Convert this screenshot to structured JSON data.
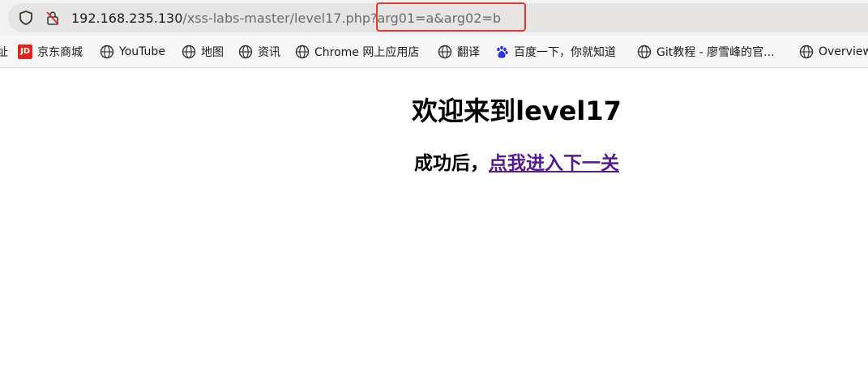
{
  "browser": {
    "url_host": "192.168.235.130",
    "url_path": "/xss-labs-master/level17.php?arg01=a&arg02=b",
    "icons": {
      "shield": "shield-icon",
      "lock": "lock-crossed-icon"
    },
    "highlight_color": "#e53935"
  },
  "bookmarks": {
    "items": [
      {
        "label": "址",
        "icon": "none"
      },
      {
        "label": "京东商城",
        "icon": "jd-icon"
      },
      {
        "label": "YouTube",
        "icon": "globe-icon"
      },
      {
        "label": "地图",
        "icon": "globe-icon"
      },
      {
        "label": "资讯",
        "icon": "globe-icon"
      },
      {
        "label": "Chrome 网上应用店",
        "icon": "globe-icon"
      },
      {
        "label": "翻译",
        "icon": "globe-icon"
      },
      {
        "label": "百度一下，你就知道",
        "icon": "baidu-paw-icon"
      },
      {
        "label": "Git教程 - 廖雪峰的官...",
        "icon": "globe-icon"
      },
      {
        "label": "Overview",
        "icon": "globe-icon"
      }
    ],
    "jd_badge": "JD"
  },
  "page": {
    "title": "欢迎来到level17",
    "success_prefix": "成功后，",
    "next_link": "点我进入下一关",
    "link_color": "#551a8b"
  }
}
